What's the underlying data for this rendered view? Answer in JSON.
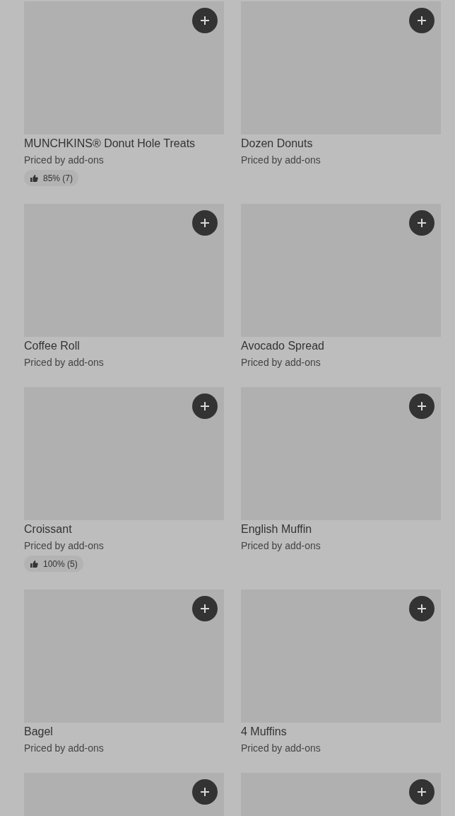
{
  "items": [
    {
      "kind": "product",
      "name": "MUNCHKINS® Donut Hole Treats",
      "price": "Priced by add-ons",
      "rating": "85% (7)"
    },
    {
      "kind": "product",
      "name": "Dozen Donuts",
      "price": "Priced by add-ons"
    },
    {
      "kind": "product",
      "name": "Coffee Roll",
      "price": "Priced by add-ons"
    },
    {
      "kind": "product",
      "name": "Avocado Spread",
      "price": "Priced by add-ons"
    },
    {
      "kind": "product",
      "name": "Croissant",
      "price": "Priced by add-ons",
      "rating": "100% (5)"
    },
    {
      "kind": "product",
      "name": "English Muffin",
      "price": "Priced by add-ons"
    },
    {
      "kind": "product",
      "name": "Bagel",
      "price": "Priced by add-ons"
    },
    {
      "kind": "product",
      "name": "4 Muffins",
      "price": "Priced by add-ons"
    },
    {
      "kind": "picture"
    },
    {
      "kind": "picture"
    }
  ]
}
